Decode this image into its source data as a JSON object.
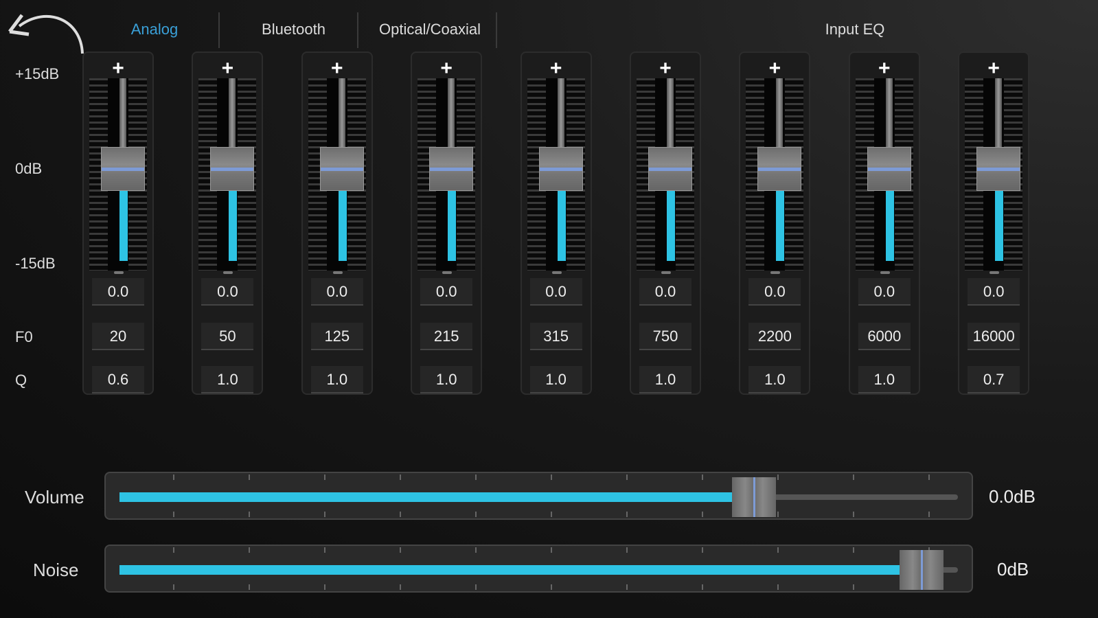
{
  "tabs": [
    {
      "label": "Analog",
      "active": true
    },
    {
      "label": "Bluetooth",
      "active": false
    },
    {
      "label": "Optical/Coaxial",
      "active": false
    }
  ],
  "section_title": "Input EQ",
  "scale": {
    "top": "+15dB",
    "mid": "0dB",
    "bottom": "-15dB",
    "f0": "F0",
    "q": "Q"
  },
  "bands": [
    {
      "gain": "0.0",
      "f0": "20",
      "q": "0.6"
    },
    {
      "gain": "0.0",
      "f0": "50",
      "q": "1.0"
    },
    {
      "gain": "0.0",
      "f0": "125",
      "q": "1.0"
    },
    {
      "gain": "0.0",
      "f0": "215",
      "q": "1.0"
    },
    {
      "gain": "0.0",
      "f0": "315",
      "q": "1.0"
    },
    {
      "gain": "0.0",
      "f0": "750",
      "q": "1.0"
    },
    {
      "gain": "0.0",
      "f0": "2200",
      "q": "1.0"
    },
    {
      "gain": "0.0",
      "f0": "6000",
      "q": "1.0"
    },
    {
      "gain": "0.0",
      "f0": "16000",
      "q": "0.7"
    }
  ],
  "band_gain_range": [
    -15,
    15
  ],
  "volume": {
    "label": "Volume",
    "value": "0.0dB",
    "level": 0.77
  },
  "noise": {
    "label": "Noise",
    "value": "0dB",
    "level": 0.98
  },
  "colors": {
    "accent": "#2ec3e4",
    "tab_active": "#3aa0d8",
    "knob_line": "#7d9bd6"
  }
}
